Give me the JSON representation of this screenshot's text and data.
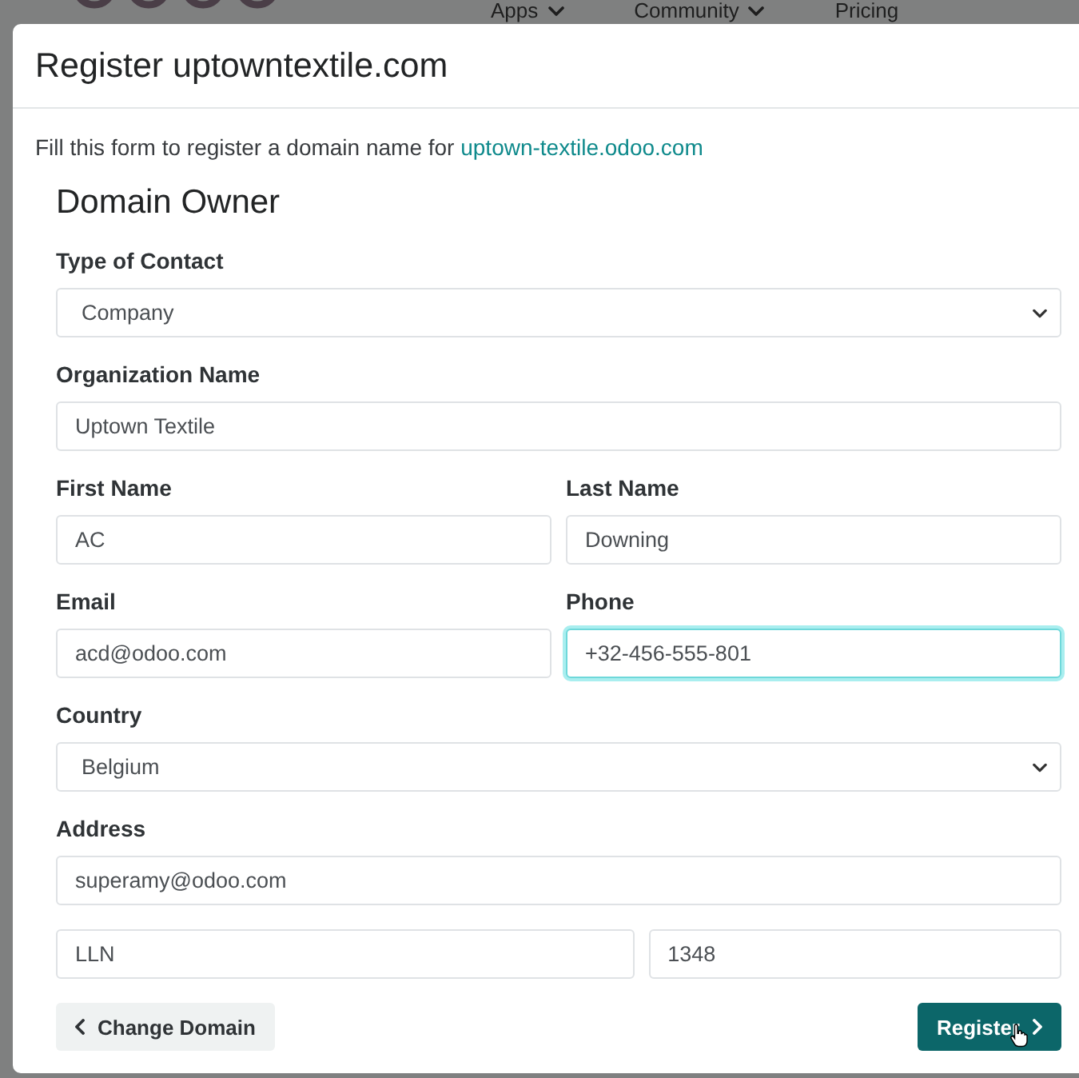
{
  "nav": [
    {
      "label": "Apps",
      "dropdown": true
    },
    {
      "label": "Community",
      "dropdown": true
    },
    {
      "label": "Pricing",
      "dropdown": false
    }
  ],
  "dialog": {
    "title": "Register uptowntextile.com",
    "intro": {
      "text": "Fill this form to register a domain name for ",
      "link": "uptown-textile.odoo.com"
    },
    "section_title": "Domain Owner",
    "rows": [
      {
        "fields": [
          {
            "label": "Type of Contact",
            "kind": "select",
            "value": "Company",
            "focused": false
          }
        ]
      },
      {
        "fields": [
          {
            "label": "Organization Name",
            "kind": "text",
            "value": "Uptown Textile",
            "focused": false
          }
        ]
      },
      {
        "fields": [
          {
            "label": "First Name",
            "kind": "text",
            "value": "AC",
            "focused": false
          },
          {
            "label": "Last Name",
            "kind": "text",
            "value": "Downing",
            "focused": false
          }
        ]
      },
      {
        "fields": [
          {
            "label": "Email",
            "kind": "text",
            "value": "acd@odoo.com",
            "focused": false
          },
          {
            "label": "Phone",
            "kind": "text",
            "value": "+32-456-555-801",
            "focused": true
          }
        ]
      },
      {
        "fields": [
          {
            "label": "Country",
            "kind": "select",
            "value": "Belgium",
            "focused": false
          }
        ]
      },
      {
        "fields": [
          {
            "label": "Address",
            "kind": "text",
            "value": "superamy@odoo.com",
            "focused": false
          }
        ]
      },
      {
        "fields": [
          {
            "kind": "text",
            "value": "LLN",
            "focused": false
          },
          {
            "kind": "text",
            "value": "1348",
            "focused": false
          }
        ]
      }
    ],
    "buttons": [
      {
        "label": "Change Domain",
        "kind": "back"
      },
      {
        "label": "Register",
        "kind": "submit"
      }
    ]
  }
}
